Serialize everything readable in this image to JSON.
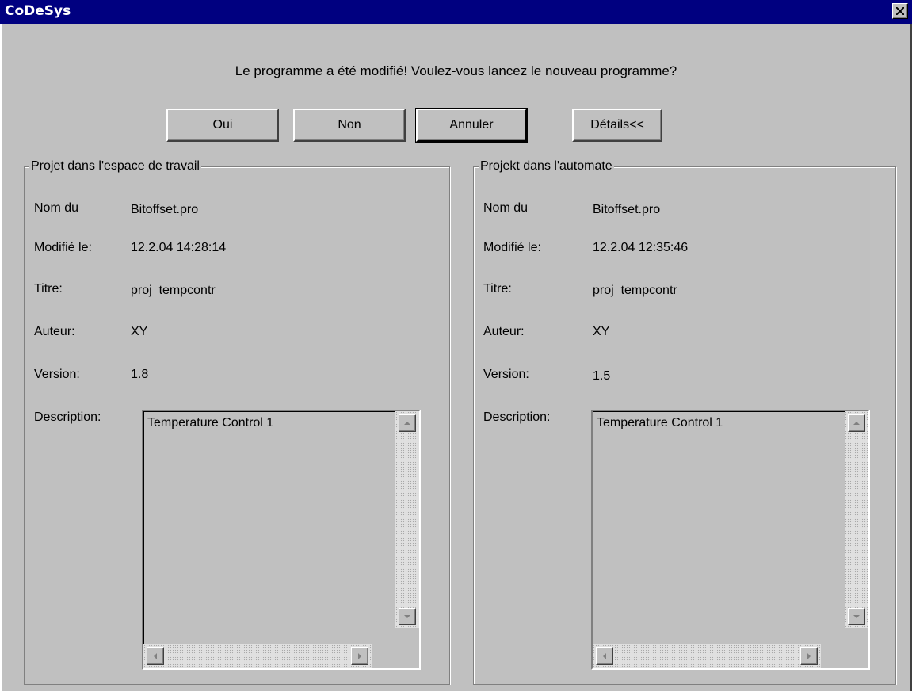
{
  "window": {
    "title": "CoDeSys",
    "close_icon": "close-icon"
  },
  "dialog": {
    "message": "Le programme a été modifié! Voulez-vous lancez le nouveau programme?",
    "buttons": {
      "yes": "Oui",
      "no": "Non",
      "cancel": "Annuler",
      "details": "Détails<<"
    }
  },
  "workspace": {
    "group_title": "Projet dans l'espace de travail",
    "labels": {
      "name": "Nom du",
      "modified": "Modifié le:",
      "title": "Titre:",
      "author": "Auteur:",
      "version": "Version:",
      "description": "Description:"
    },
    "values": {
      "name": "Bitoffset.pro",
      "modified": "12.2.04 14:28:14",
      "title": "proj_tempcontr",
      "author": "XY",
      "version": "1.8",
      "description": "Temperature Control 1"
    }
  },
  "plc": {
    "group_title": "Projekt dans l'automate",
    "labels": {
      "name": "Nom du",
      "modified": "Modifié le:",
      "title": "Titre:",
      "author": "Auteur:",
      "version": "Version:",
      "description": "Description:"
    },
    "values": {
      "name": "Bitoffset.pro",
      "modified": "12.2.04 12:35:46",
      "title": "proj_tempcontr",
      "author": "XY",
      "version": "1.5",
      "description": "Temperature Control 1"
    }
  }
}
